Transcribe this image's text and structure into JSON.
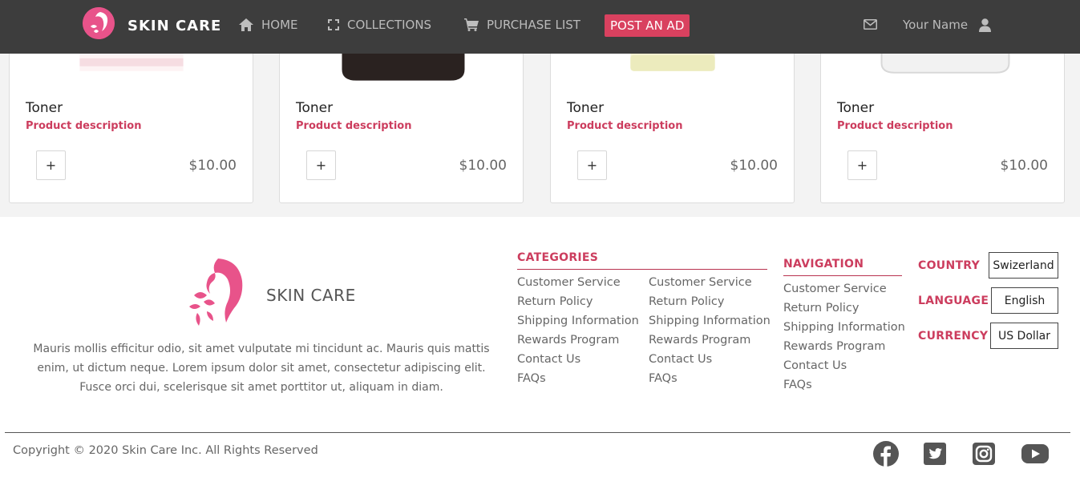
{
  "navbar": {
    "brand": "SKIN CARE",
    "items": [
      {
        "label": "HOME",
        "icon": "home-icon"
      },
      {
        "label": "COLLECTIONS",
        "icon": "expand-icon"
      },
      {
        "label": "PURCHASE LIST",
        "icon": "cart-icon"
      }
    ],
    "post_ad": "POST AN AD",
    "user_name": "Your Name",
    "accent_color": "#d9415f",
    "background_color": "#3d3d3d"
  },
  "products": [
    {
      "name": "Toner",
      "description": "Product description",
      "add_label": "+",
      "price": "$10.00"
    },
    {
      "name": "Toner",
      "description": "Product description",
      "add_label": "+",
      "price": "$10.00"
    },
    {
      "name": "Toner",
      "description": "Product description",
      "add_label": "+",
      "price": "$10.00"
    },
    {
      "name": "Toner",
      "description": "Product description",
      "add_label": "+",
      "price": "$10.00"
    }
  ],
  "footer": {
    "brand": "SKIN CARE",
    "about": "Mauris mollis efficitur odio, sit amet vulputate mi tincidunt ac. Mauris quis mattis enim, ut dictum neque. Lorem ipsum dolor sit amet, consectetur adipiscing elit. Fusce orci dui, scelerisque sit amet porttitor ut, aliquam in diam.",
    "categories": {
      "title": "CATEGORIES",
      "col1": [
        "Customer Service",
        "Return Policy",
        "Shipping Information",
        "Rewards Program",
        "Contact Us",
        "FAQs"
      ],
      "col2": [
        "Customer Service",
        "Return Policy",
        "Shipping Information",
        "Rewards Program",
        "Contact Us",
        "FAQs"
      ]
    },
    "navigation": {
      "title": "NAVIGATION",
      "links": [
        "Customer Service",
        "Return Policy",
        "Shipping Information",
        "Rewards Program",
        "Contact Us",
        "FAQs"
      ]
    },
    "settings": {
      "country_label": "COUNTRY",
      "country_value": "Swizerland",
      "language_label": "LANGUAGE",
      "language_value": "English",
      "currency_label": "CURRENCY",
      "currency_value": "US Dollar"
    },
    "copyright": "Copyright © 2020 Skin Care Inc. All Rights Reserved",
    "social": [
      "facebook-icon",
      "twitter-icon",
      "instagram-icon",
      "youtube-icon"
    ],
    "accent_color": "#cc3d5e"
  }
}
